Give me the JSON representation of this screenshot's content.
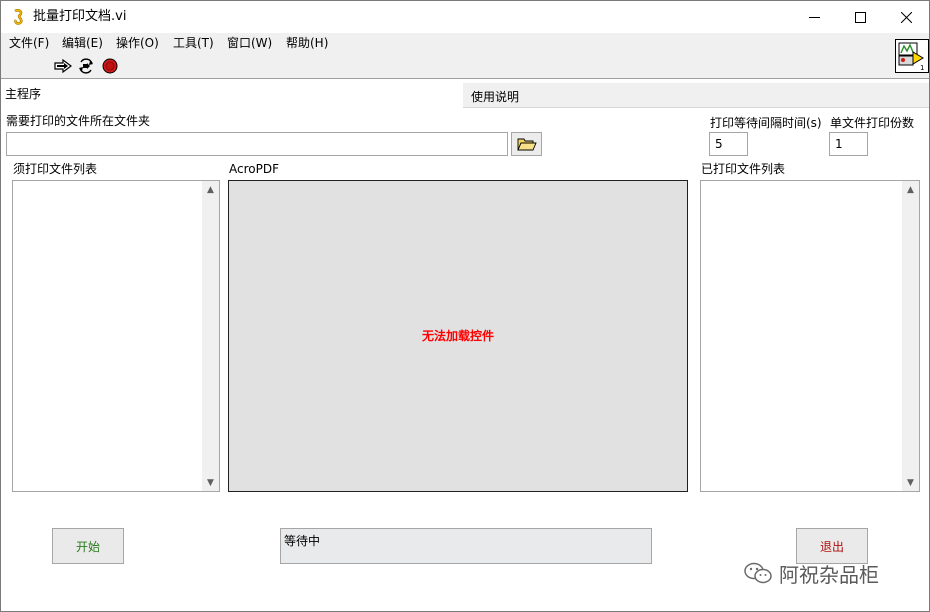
{
  "window": {
    "title": "批量打印文档.vi"
  },
  "menu": {
    "items": [
      "文件(F)",
      "编辑(E)",
      "操作(O)",
      "工具(T)",
      "窗口(W)",
      "帮助(H)"
    ]
  },
  "toolbar": {
    "run_icon": "run-arrow-icon",
    "run_continuous_icon": "run-continuously-icon",
    "abort_icon": "abort-icon"
  },
  "vi_icon": {
    "badge": "1"
  },
  "tabs": [
    {
      "label": "主程序",
      "active": true
    },
    {
      "label": "使用说明",
      "active": false
    }
  ],
  "main": {
    "folder_label": "需要打印的文件所在文件夹",
    "folder_value": "",
    "wait_label": "打印等待间隔时间(s)",
    "wait_value": "5",
    "copies_label": "单文件打印份数",
    "copies_value": "1",
    "todo_list_label": "须打印文件列表",
    "acro_label": "AcroPDF",
    "acro_message": "无法加载控件",
    "done_list_label": "已打印文件列表",
    "start_label": "开始",
    "status_text": "等待中",
    "exit_label": "退出"
  },
  "watermark": {
    "text": "阿祝杂品柜"
  },
  "colors": {
    "error_text": "#ff0000",
    "start_text": "#2a7a1e",
    "exit_text": "#b01010",
    "abort_red": "#d11a1a"
  }
}
